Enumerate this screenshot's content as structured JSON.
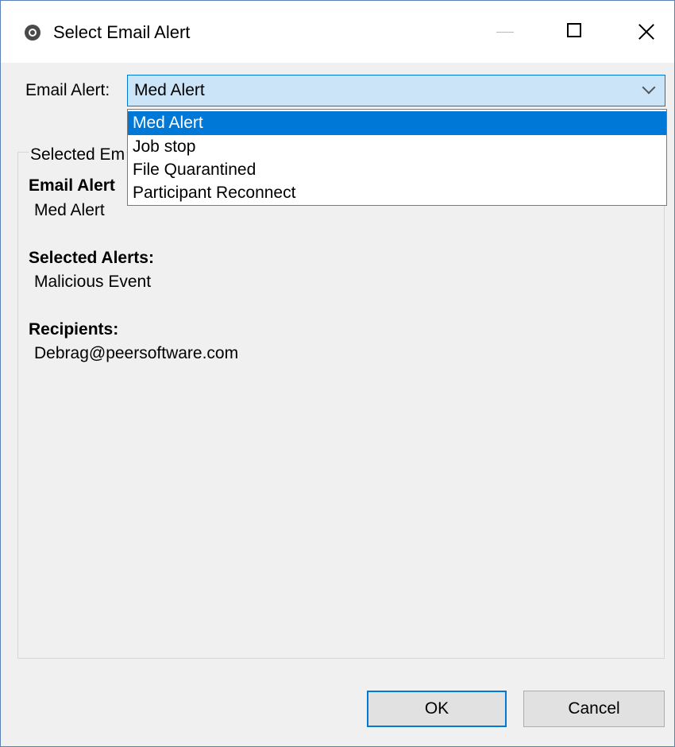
{
  "window": {
    "title": "Select Email Alert",
    "icon": "peer-app-icon"
  },
  "form": {
    "email_alert_label": "Email Alert:",
    "email_alert_value": "Med Alert",
    "dropdown_options": [
      "Med Alert",
      "Job stop",
      "File Quarantined",
      "Participant Reconnect"
    ],
    "selected_option_index": 0
  },
  "details": {
    "group_title": "Selected Em",
    "email_alert_heading": "Email Alert",
    "email_alert_value": "Med Alert",
    "selected_alerts_heading": "Selected Alerts:",
    "selected_alerts_value": "Malicious Event",
    "recipients_heading": "Recipients:",
    "recipients_value": "Debrag@peersoftware.com"
  },
  "buttons": {
    "ok": "OK",
    "cancel": "Cancel"
  },
  "colors": {
    "accent": "#0078d7",
    "combo_bg": "#cce4f7",
    "dialog_bg": "#f0f0f0"
  }
}
